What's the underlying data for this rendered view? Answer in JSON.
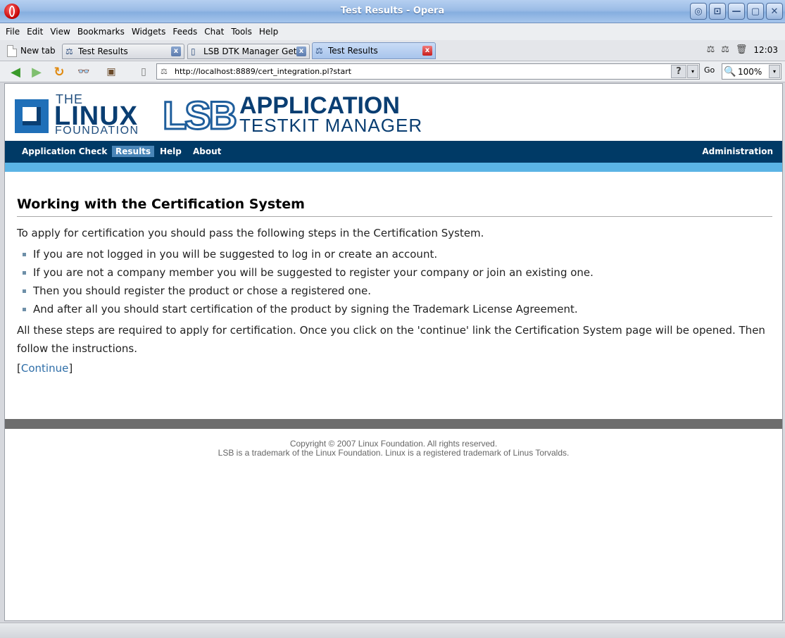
{
  "window": {
    "title": "Test Results - Opera",
    "buttons": [
      "◎",
      "⊡",
      "—",
      "▢",
      "✕"
    ]
  },
  "menu": [
    "File",
    "Edit",
    "View",
    "Bookmarks",
    "Widgets",
    "Feeds",
    "Chat",
    "Tools",
    "Help"
  ],
  "tabs": {
    "new_tab_label": "New tab",
    "items": [
      {
        "label": "Test Results",
        "favicon": "⚖"
      },
      {
        "label": "LSB DTK Manager Get...",
        "favicon": "▯"
      },
      {
        "label": "Test Results",
        "favicon": "⚖"
      }
    ],
    "close_glyph": "x",
    "clock": "12:03",
    "tray_icons": [
      "⚖",
      "⚖",
      "🗑"
    ]
  },
  "address": {
    "url": "http://localhost:8889/cert_integration.pl?start",
    "help_glyph": "?",
    "go_label": "Go",
    "zoom": "100%",
    "dropdown_glyph": "▾"
  },
  "toolbar_icons": {
    "back": "◀",
    "forward": "▶",
    "reload": "↻",
    "glasses": "👓",
    "image": "▣",
    "page": "▯"
  },
  "header": {
    "lf_the": "THE",
    "lf_linux": "LINUX",
    "lf_foundation": "FOUNDATION",
    "lsb_mark": "LSB",
    "lsb_application": "APPLICATION",
    "lsb_testkit": "TESTKIT MANAGER"
  },
  "nav": {
    "items": [
      "Application Check",
      "Results",
      "Help",
      "About"
    ],
    "selected": "Results",
    "admin": "Administration"
  },
  "content": {
    "heading": "Working with the Certification System",
    "intro": "To apply for certification you should pass the following steps in the Certification System.",
    "steps": [
      "If you are not logged in you will be suggested to log in or create an account.",
      "If you are not a company member you will be suggested to register your company or join an existing one.",
      "Then you should register the product or chose a registered one.",
      "And after all you should start certification of the product by signing the Trademark License Agreement."
    ],
    "outro": "All these steps are required to apply for certification. Once you click on the 'continue' link the Certification System page will be opened. Then follow the instructions.",
    "continue_open": "[",
    "continue_link": "Continue",
    "continue_close": "]"
  },
  "footer": {
    "copyright": "Copyright © 2007 Linux Foundation. All rights reserved.",
    "trademark": "LSB is a trademark of the Linux Foundation. Linux is a registered trademark of Linus Torvalds."
  }
}
